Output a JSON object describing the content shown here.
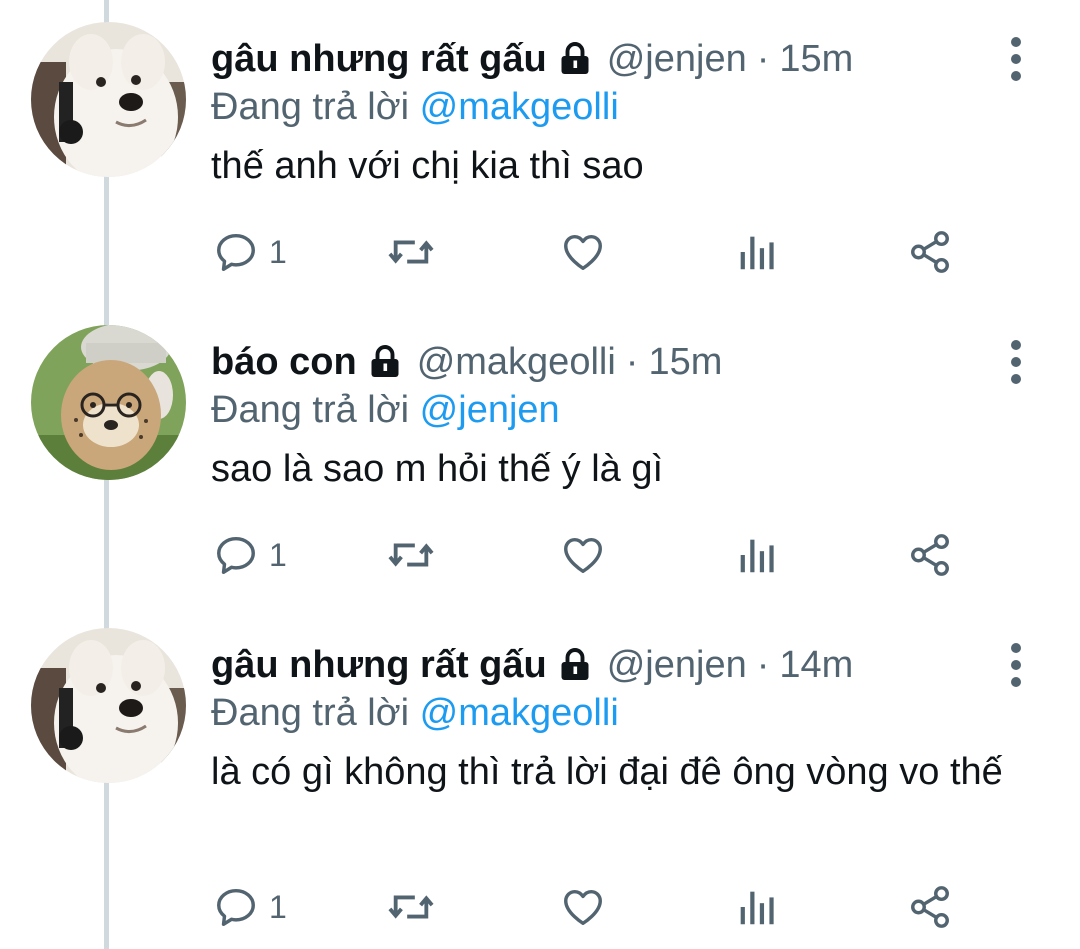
{
  "tweets": [
    {
      "display_name": "gâu nhưng rất gấu",
      "handle": "@jenjen",
      "separator": "·",
      "time": "15m",
      "reply_prefix": "Đang trả lời",
      "reply_to": "@makgeolli",
      "text": "thế anh với chị kia thì sao",
      "reply_count": "1",
      "avatar": "white-dog-avatar"
    },
    {
      "display_name": "báo con",
      "handle": "@makgeolli",
      "separator": "·",
      "time": "15m",
      "reply_prefix": "Đang trả lời",
      "reply_to": "@jenjen",
      "text": "sao là sao m hỏi thế ý là gì",
      "reply_count": "1",
      "avatar": "cheetah-cub-avatar"
    },
    {
      "display_name": "gâu nhưng rất gấu",
      "handle": "@jenjen",
      "separator": "·",
      "time": "14m",
      "reply_prefix": "Đang trả lời",
      "reply_to": "@makgeolli",
      "text": "là có gì không thì trả lời đại đê ông vòng vo thế",
      "reply_count": "1",
      "avatar": "white-dog-avatar"
    }
  ],
  "colors": {
    "text": "#0f1419",
    "secondary": "#536471",
    "mention": "#1d9bf0",
    "thread_line": "#cfd9de"
  },
  "icons": [
    "lock-icon",
    "more-icon",
    "reply-icon",
    "retweet-icon",
    "like-icon",
    "views-icon",
    "share-icon"
  ]
}
